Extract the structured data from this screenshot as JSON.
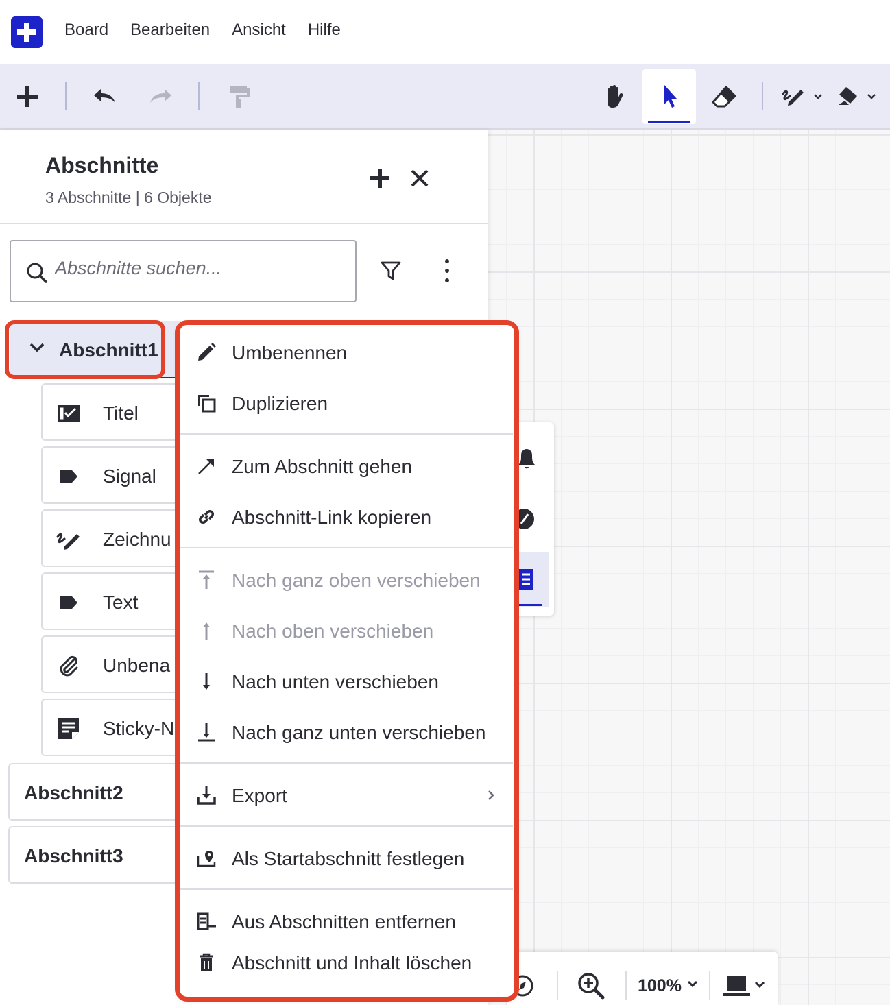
{
  "menubar": {
    "items": [
      "Board",
      "Bearbeiten",
      "Ansicht",
      "Hilfe"
    ]
  },
  "toolbar": {
    "tools": [
      "plus-icon",
      "undo-icon",
      "redo-icon",
      "format-painter-icon",
      "hand-icon",
      "pointer-icon",
      "eraser-icon",
      "pen-icon",
      "fill-icon"
    ],
    "active_tool": "pointer-icon"
  },
  "panel": {
    "title": "Abschnitte",
    "subtitle": "3 Abschnitte | 6 Objekte",
    "search_placeholder": "Abschnitte suchen...",
    "sections": [
      {
        "label": "Abschnitt1",
        "expanded": true,
        "objects": [
          {
            "icon": "title-icon",
            "label": "Titel"
          },
          {
            "icon": "label-tag-icon",
            "label": "Signal"
          },
          {
            "icon": "drawing-icon",
            "label": "Zeichnu"
          },
          {
            "icon": "label-tag-icon",
            "label": "Text"
          },
          {
            "icon": "paperclip-icon",
            "label": "Unbena"
          },
          {
            "icon": "sticky-note-icon",
            "label": "Sticky-N"
          }
        ]
      },
      {
        "label": "Abschnitt2"
      },
      {
        "label": "Abschnitt3"
      }
    ]
  },
  "context_menu": {
    "items": [
      {
        "icon": "pencil-icon",
        "label": "Umbenennen",
        "enabled": true
      },
      {
        "icon": "duplicate-icon",
        "label": "Duplizieren",
        "enabled": true
      },
      {
        "icon": "arrow-up-right-icon",
        "label": "Zum Abschnitt gehen",
        "enabled": true
      },
      {
        "icon": "link-icon",
        "label": "Abschnitt-Link kopieren",
        "enabled": true
      },
      {
        "icon": "move-top-icon",
        "label": "Nach ganz oben verschieben",
        "enabled": false
      },
      {
        "icon": "move-up-icon",
        "label": "Nach oben verschieben",
        "enabled": false
      },
      {
        "icon": "move-down-icon",
        "label": "Nach unten verschieben",
        "enabled": true
      },
      {
        "icon": "move-bottom-icon",
        "label": "Nach ganz unten verschieben",
        "enabled": true
      },
      {
        "icon": "export-icon",
        "label": "Export",
        "enabled": true,
        "submenu": true
      },
      {
        "icon": "start-location-icon",
        "label": "Als Startabschnitt festlegen",
        "enabled": true
      },
      {
        "icon": "remove-from-sections-icon",
        "label": "Aus Abschnitten entfernen",
        "enabled": true
      },
      {
        "icon": "trash-icon",
        "label": "Abschnitt und Inhalt löschen",
        "enabled": true
      }
    ]
  },
  "bottombar": {
    "zoom": "100%"
  },
  "colors": {
    "accent": "#1c23c9",
    "highlight": "#e4412b",
    "toolbar_bg": "#e9eaf6"
  }
}
